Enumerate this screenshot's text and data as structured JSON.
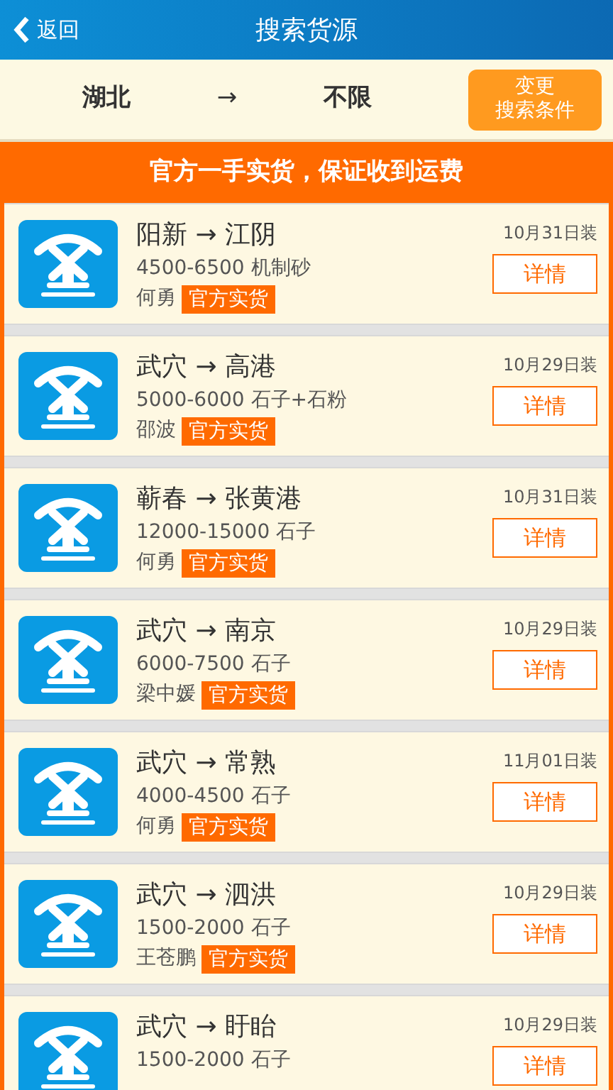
{
  "header": {
    "back": "返回",
    "title": "搜索货源"
  },
  "filter": {
    "from": "湖北",
    "arrow": "→",
    "to": "不限",
    "button": [
      "变更",
      "搜索条件"
    ]
  },
  "banner": "官方一手实货，保证收到运费",
  "cargo": [
    {
      "route": "阳新 → 江阴",
      "cargo": "4500-6500 机制砂",
      "name": "何勇",
      "badge": "官方实货",
      "date": "10月31日装",
      "button": "详情"
    },
    {
      "route": "武穴 → 高港",
      "cargo": "5000-6000 石子+石粉",
      "name": "邵波",
      "badge": "官方实货",
      "date": "10月29日装",
      "button": "详情"
    },
    {
      "route": "蕲春 → 张黄港",
      "cargo": "12000-15000 石子",
      "name": "何勇",
      "badge": "官方实货",
      "date": "10月31日装",
      "button": "详情"
    },
    {
      "route": "武穴 → 南京",
      "cargo": "6000-7500 石子",
      "name": "梁中媛",
      "badge": "官方实货",
      "date": "10月29日装",
      "button": "详情"
    },
    {
      "route": "武穴 → 常熟",
      "cargo": "4000-4500 石子",
      "name": "何勇",
      "badge": "官方实货",
      "date": "11月01日装",
      "button": "详情"
    },
    {
      "route": "武穴 → 泗洪",
      "cargo": "1500-2000 石子",
      "name": "王苍鹏",
      "badge": "官方实货",
      "date": "10月29日装",
      "button": "详情"
    },
    {
      "route": "武穴 → 盱眙",
      "cargo": "1500-2000 石子",
      "date": "10月29日装",
      "button": "详情"
    }
  ]
}
